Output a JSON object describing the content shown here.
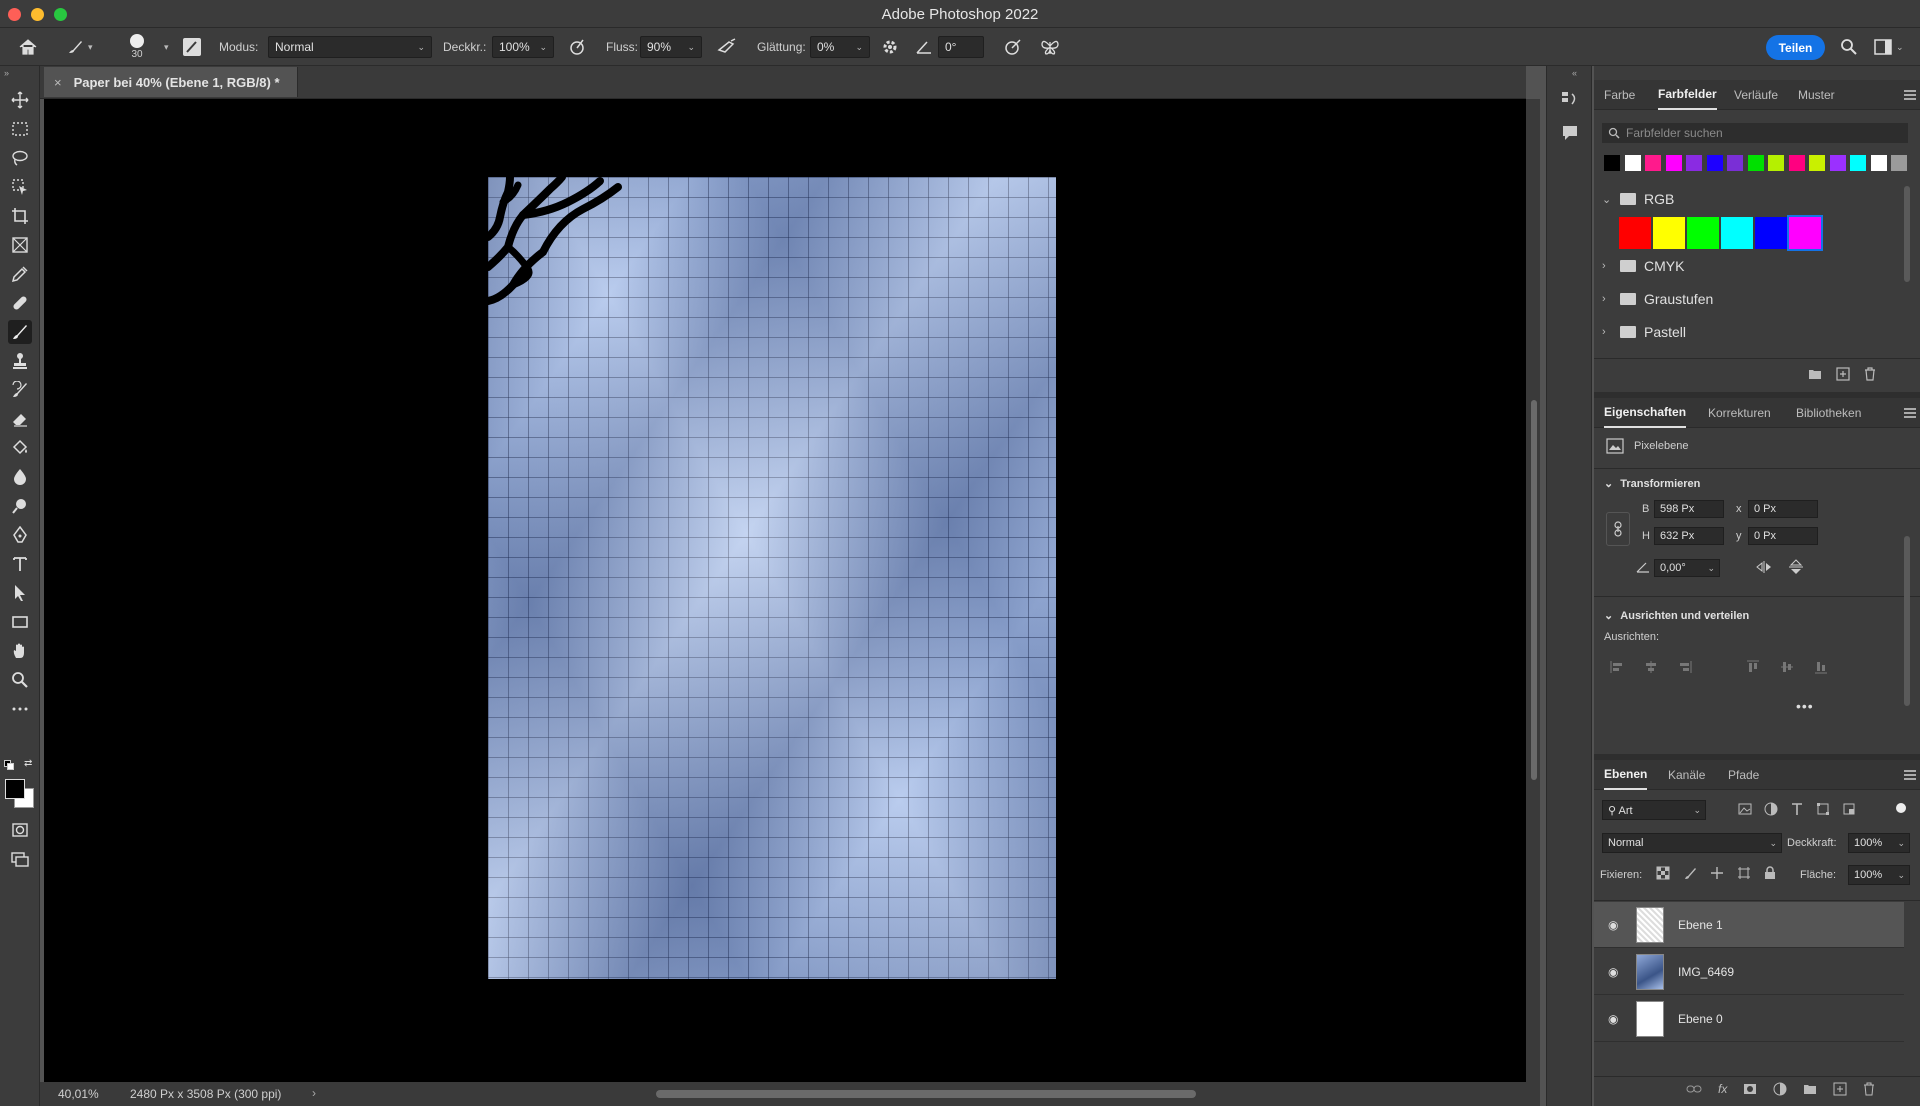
{
  "app": {
    "window_title": "Adobe Photoshop 2022"
  },
  "options_bar": {
    "brush_size": "30",
    "mode_label": "Modus:",
    "mode_value": "Normal",
    "opacity_label": "Deckkr.:",
    "opacity_value": "100%",
    "flow_label": "Fluss:",
    "flow_value": "90%",
    "smoothing_label": "Glättung:",
    "smoothing_value": "0%",
    "angle_value": "0°",
    "share_label": "Teilen"
  },
  "document": {
    "tab_title": "Paper bei 40% (Ebene 1, RGB/8) *",
    "zoom": "40,01%",
    "doc_info": "2480 Px x 3508 Px (300 ppi)"
  },
  "swatches_panel": {
    "tabs": [
      "Farbe",
      "Farbfelder",
      "Verläufe",
      "Muster"
    ],
    "active_tab": "Farbfelder",
    "search_placeholder": "Farbfelder suchen",
    "recent_colors": [
      "#000000",
      "#ffffff",
      "#ff1a8c",
      "#ff00ff",
      "#8a2be2",
      "#1e00ff",
      "#7a2fd6",
      "#00e000",
      "#b5f000",
      "#ff0080",
      "#c9f000",
      "#9b30ff",
      "#00ffff",
      "#ffffff",
      "#9a9a9a"
    ],
    "groups": [
      {
        "name": "RGB",
        "expanded": true,
        "colors": [
          "#ff0000",
          "#ffff00",
          "#00ff00",
          "#00ffff",
          "#0000ff",
          "#ff00ff"
        ]
      },
      {
        "name": "CMYK",
        "expanded": false
      },
      {
        "name": "Graustufen",
        "expanded": false
      },
      {
        "name": "Pastell",
        "expanded": false
      }
    ]
  },
  "properties_panel": {
    "tabs": [
      "Eigenschaften",
      "Korrekturen",
      "Bibliotheken"
    ],
    "active_tab": "Eigenschaften",
    "type_label": "Pixelebene",
    "transform_heading": "Transformieren",
    "w_label": "B",
    "w_value": "598 Px",
    "h_label": "H",
    "h_value": "632 Px",
    "x_label": "x",
    "x_value": "0 Px",
    "y_label": "y",
    "y_value": "0 Px",
    "angle_value": "0,00°",
    "align_heading": "Ausrichten und verteilen",
    "align_label": "Ausrichten:"
  },
  "layers_panel": {
    "tabs": [
      "Ebenen",
      "Kanäle",
      "Pfade"
    ],
    "active_tab": "Ebenen",
    "filter_value": "Art",
    "blend_mode": "Normal",
    "opacity_label": "Deckkraft:",
    "opacity_value": "100%",
    "lock_label": "Fixieren:",
    "fill_label": "Fläche:",
    "fill_value": "100%",
    "layers": [
      {
        "name": "Ebene 1",
        "selected": true
      },
      {
        "name": "IMG_6469",
        "selected": false
      },
      {
        "name": "Ebene 0",
        "selected": false
      }
    ]
  }
}
